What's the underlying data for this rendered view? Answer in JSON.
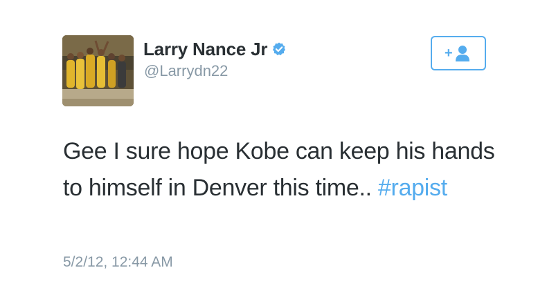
{
  "tweet": {
    "author": {
      "display_name": "Larry Nance Jr",
      "handle": "@Larrydn22",
      "verified": true,
      "avatar_icon": "basketball-team-photo"
    },
    "follow_button": {
      "label": "+",
      "icon": "follow-person-icon"
    },
    "text_before_hashtag": "Gee I sure hope Kobe can keep his hands to himself in Denver this time.. ",
    "hashtag": "#rapist",
    "timestamp": "5/2/12, 12:44 AM"
  },
  "colors": {
    "text": "#292f33",
    "muted": "#8899a6",
    "accent": "#55acee",
    "background": "#ffffff"
  }
}
